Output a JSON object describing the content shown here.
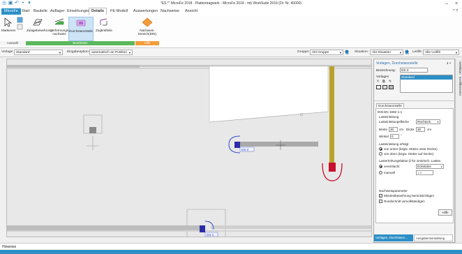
{
  "titlebar": {
    "title": "\"ES *\" MicroFe 2018 - Plattentragwerk - MicroFe 2018 - mb WorkSuite 2018 (Dt. Nr. 40000)",
    "minimize": "–",
    "close": "×"
  },
  "menu": {
    "file": "MicroFe",
    "tabs": [
      "Start",
      "Bauteile",
      "Auflager",
      "Einwirkungen",
      "Details",
      "FE-Modell",
      "Auswertungen",
      "Nachweise",
      "Ansicht"
    ],
    "active": "Details",
    "help": "^ ?"
  },
  "ribbon": {
    "markieren": "Markieren",
    "zulage": "Zulagebewehrung",
    "verformung": "Verformungs-nachweis",
    "durchstanz": "Durchstanzstelle",
    "zugkraft": "Zugkrafteile",
    "nachweis": "Nachweis-bereich(DIN)",
    "groups": {
      "auswahl": "Auswahl",
      "bearbeiten": "Bearbeiten",
      "hilfe": "Hilfe"
    }
  },
  "toolrow": {
    "vorlage_label": "Vorlage",
    "vorlage_value": "Standard",
    "eingabe_label": "Eingabeoption:",
    "eingabe_value": "automatisch an Position",
    "gruppe_label": "Gruppe:",
    "gruppe_value": "Akt Gruppe",
    "situation_label": "Situation:",
    "situation_value": "Akt Situation",
    "leitfilt_label": "Leitfilt:",
    "leitfilt_value": "Alle Leitfilt"
  },
  "canvas": {
    "ds_label_1": "DS-2",
    "ds_label_2": "DS-1"
  },
  "panel": {
    "title": "Vorlagen, Durchstanzstelle",
    "title_controls": "4 ×",
    "bezeichnung_label": "Bezeichnung:",
    "bezeichnung_value": "DS-3",
    "vorlagen_label": "Vorlagen",
    "vorlagen_selected": "Standard",
    "section": "Durchstanzstelle",
    "norm": "DIN EN 1992-1-1",
    "lasteinleitung": "Lasteinleitung",
    "lastfläche_label": "Lasteinleitungsfläche",
    "lastfläche_value": "Rechteck",
    "breite_label": "Breite",
    "breite_value": "30",
    "cm1": "cm",
    "dicke_label": "Dicke",
    "dicke_value": "30",
    "cm2": "cm",
    "winkel_label": "Winkel",
    "winkel_value": "0",
    "deg": "°",
    "lasteinl_erfolgt": "Lasteinleitung erfolgt",
    "radio_unten": "von unten (bzgw. Stütze unter Decke)",
    "radio_oben": "von oben (bzgw. Stütze auf Decke)",
    "lastfaktor": "Lasterhöhungsfaktor β für zentrisch. Lasten",
    "radio_vereinfacht": "vereinfacht",
    "vereinfacht_value": "Eckstütze",
    "radio_manuell": "manuell",
    "manuell_value": "1.5",
    "nachweisparameter": "Nachweisparameter",
    "chk_mindest": "Mindestbewehrung berücksichtigen",
    "chk_rundschnitt": "Rundschnitt vervollständigen",
    "hilfe": "Hilfe",
    "tab1": "Vorlagen, Durchstanz...",
    "tab2": "Ausgabenverwaltung"
  },
  "sidestrip": {
    "tab1": "Selektion",
    "tab2": "Konfliktcenter"
  },
  "bottom": {
    "hinweise": "Hinweise"
  }
}
